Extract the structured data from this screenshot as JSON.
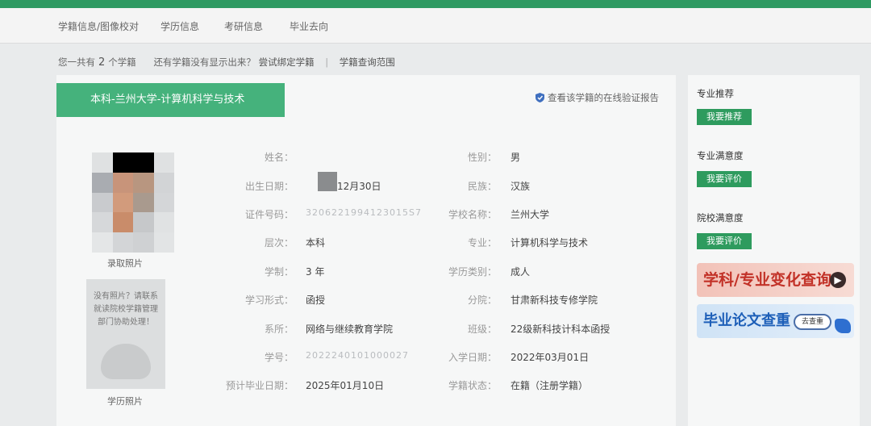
{
  "nav": {
    "items": [
      "学籍信息/图像校对",
      "学历信息",
      "考研信息",
      "毕业去向"
    ]
  },
  "summary": {
    "prefix": "您一共有",
    "count": "2",
    "suffix": "个学籍",
    "question": "还有学籍没有显示出来？",
    "bind_link": "尝试绑定学籍",
    "sep": "|",
    "scope_link": "学籍查询范围"
  },
  "record": {
    "ribbon": "本科-兰州大学-计算机科学与技术",
    "verify_link": "查看该学籍的在线验证报告",
    "photo_caption": "录取照片",
    "no_photo_msg": "没有照片？请联系就读院校学籍管理部门协助处理！",
    "grad_photo_caption": "学历照片",
    "left_fields": [
      {
        "label": "姓名：",
        "value": ""
      },
      {
        "label": "出生日期：",
        "value": "12月30日"
      },
      {
        "label": "证件号码：",
        "value": "3206221994123015S7"
      },
      {
        "label": "层次：",
        "value": "本科"
      },
      {
        "label": "学制：",
        "value": "3 年"
      },
      {
        "label": "学习形式：",
        "value": "函授"
      },
      {
        "label": "系所：",
        "value": "网络与继续教育学院"
      },
      {
        "label": "学号：",
        "value": "2022240101000027"
      },
      {
        "label": "预计毕业日期：",
        "value": "2025年01月10日"
      }
    ],
    "right_fields": [
      {
        "label": "性别：",
        "value": "男"
      },
      {
        "label": "民族：",
        "value": "汉族"
      },
      {
        "label": "学校名称：",
        "value": "兰州大学"
      },
      {
        "label": "专业：",
        "value": "计算机科学与技术"
      },
      {
        "label": "学历类别：",
        "value": "成人"
      },
      {
        "label": "分院：",
        "value": "甘肃新科技专修学院"
      },
      {
        "label": "班级：",
        "value": "22级新科技计科本函授"
      },
      {
        "label": "入学日期：",
        "value": "2022年03月01日"
      },
      {
        "label": "学籍状态：",
        "value": "在籍（注册学籍）"
      }
    ]
  },
  "sidebar": {
    "sections": [
      {
        "title": "专业推荐",
        "button": "我要推荐"
      },
      {
        "title": "专业满意度",
        "button": "我要评价"
      },
      {
        "title": "院校满意度",
        "button": "我要评价"
      }
    ],
    "banner1": "学科/专业变化查询",
    "banner2": "毕业论文查重",
    "banner2_pill": "去查重"
  },
  "colors": {
    "accent": "#2f9a62",
    "ribbon": "#45b27c",
    "button": "#2e9b5e"
  }
}
